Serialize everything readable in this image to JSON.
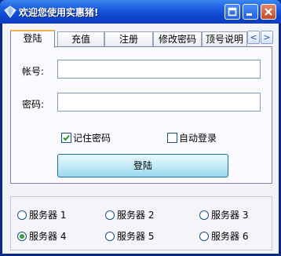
{
  "window": {
    "title": "欢迎您使用实惠猪!"
  },
  "titlebar_buttons": [
    "restore",
    "minimize",
    "close"
  ],
  "tabs": [
    {
      "label": "登陆",
      "active": true
    },
    {
      "label": "充值",
      "active": false
    },
    {
      "label": "注册",
      "active": false
    },
    {
      "label": "修改密码",
      "active": false
    },
    {
      "label": "顶号说明",
      "active": false
    }
  ],
  "tab_arrows": {
    "left": "<",
    "right": ">"
  },
  "login_form": {
    "account_label": "帐号:",
    "account_value": "",
    "password_label": "密码:",
    "password_value": "",
    "remember_password": {
      "label": "记住密码",
      "checked": true
    },
    "auto_login": {
      "label": "自动登录",
      "checked": false
    },
    "login_button": "登陆"
  },
  "servers": [
    {
      "label": "服务器 1",
      "checked": false
    },
    {
      "label": "服务器 2",
      "checked": false
    },
    {
      "label": "服务器 3",
      "checked": false
    },
    {
      "label": "服务器 4",
      "checked": true
    },
    {
      "label": "服务器 5",
      "checked": false
    },
    {
      "label": "服务器 6",
      "checked": false
    }
  ],
  "colors": {
    "titlebar": "#1d5ee0",
    "tab_active_accent": "#f0b64a",
    "button_gradient_bottom": "#9bd9ee",
    "radio_selected": "#3aa23a",
    "checkbox_check": "#21a121"
  }
}
